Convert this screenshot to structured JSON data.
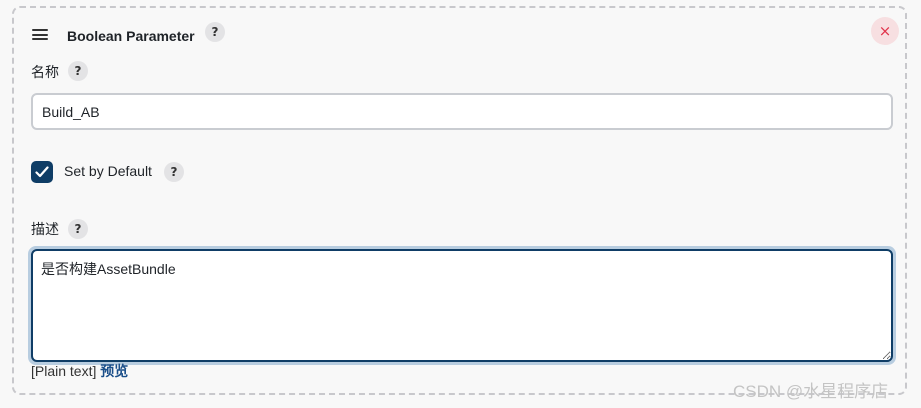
{
  "header": {
    "title": "Boolean Parameter",
    "help": "?",
    "close": "×"
  },
  "name_field": {
    "label": "名称",
    "help": "?",
    "value": "Build_AB"
  },
  "default_checkbox": {
    "label": "Set by Default",
    "help": "?",
    "checked": true
  },
  "description_field": {
    "label": "描述",
    "help": "?",
    "value": "是否构建AssetBundle"
  },
  "format": {
    "text": "[Plain text]",
    "preview_link": "预览"
  },
  "watermark": "CSDN @水星程序店",
  "colors": {
    "accent": "#0f3d66",
    "close": "#e0324a",
    "link": "#1b4f8a"
  }
}
